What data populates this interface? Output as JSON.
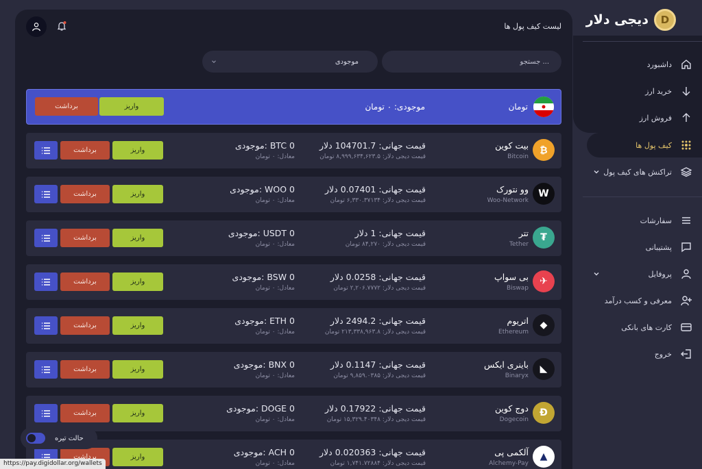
{
  "brand": {
    "name": "دیجی دلار",
    "coin_letter": "D"
  },
  "sidebar": {
    "items": [
      {
        "label": "داشبورد",
        "icon": "home-icon"
      },
      {
        "label": "خرید ارز",
        "icon": "arrow-down-icon"
      },
      {
        "label": "فروش ارز",
        "icon": "arrow-up-icon"
      },
      {
        "label": "کیف پول ها",
        "icon": "wallet-dots-icon",
        "active": true
      },
      {
        "label": "تراکنش های کیف پول",
        "icon": "layers-icon",
        "has_chevron": true
      },
      {
        "label": "سفارشات",
        "icon": "list-icon"
      },
      {
        "label": "پشتیبانی",
        "icon": "chat-icon"
      },
      {
        "label": "پروفایل",
        "icon": "user-icon",
        "has_chevron": true
      },
      {
        "label": "معرفی و کسب درآمد",
        "icon": "user-plus-icon"
      },
      {
        "label": "کارت های بانکی",
        "icon": "card-icon"
      },
      {
        "label": "خروج",
        "icon": "logout-icon"
      }
    ]
  },
  "header": {
    "title": "لیست کیف پول ها"
  },
  "search": {
    "placeholder": "جستجو ..."
  },
  "filter": {
    "selected": "موجودی"
  },
  "toman": {
    "name": "تومان",
    "balance": "موجودی: ۰ تومان",
    "deposit_label": "واریز",
    "withdraw_label": "برداشت"
  },
  "coins": [
    {
      "name": "بیت کوین",
      "sub": "Bitcoin",
      "price": "قیمت جهانی: 104701.7 دلار",
      "price_sub": "قیمت دیجی دلار: ۸,۹۹۹,۶۳۴,۶۲۳.۵ تومان",
      "balance": "موجودی: BTC 0",
      "balance_sub": "معادل: ۰ تومان",
      "icon_color": "#f0a22a",
      "icon_symbol": "₿"
    },
    {
      "name": "وو نتورک",
      "sub": "Woo-Network",
      "price": "قیمت جهانی: 0.07401 دلار",
      "price_sub": "قیمت دیجی دلار: ۶,۳۳۰.۳۷۱۳۴ تومان",
      "balance": "موجودی: WOO 0",
      "balance_sub": "معادل: ۰ تومان",
      "icon_color": "#0e0e12",
      "icon_symbol": "W"
    },
    {
      "name": "تتر",
      "sub": "Tether",
      "price": "قیمت جهانی: 1 دلار",
      "price_sub": "قیمت دیجی دلار: ۸۴,۲۷۰ تومان",
      "balance": "موجودی: USDT 0",
      "balance_sub": "معادل: ۰ تومان",
      "icon_color": "#3aa78f",
      "icon_symbol": "₮"
    },
    {
      "name": "بی سواپ",
      "sub": "Biswap",
      "price": "قیمت جهانی: 0.0258 دلار",
      "price_sub": "قیمت دیجی دلار: ۲,۲۰۶.۷۷۷۲ تومان",
      "balance": "موجودی: BSW 0",
      "balance_sub": "معادل: ۰ تومان",
      "icon_color": "#e8424f",
      "icon_symbol": "✈"
    },
    {
      "name": "اتریوم",
      "sub": "Ethereum",
      "price": "قیمت جهانی: 2494.2 دلار",
      "price_sub": "قیمت دیجی دلار: ۲۱۳,۳۳۸,۹۶۳.۸ تومان",
      "balance": "موجودی: ETH 0",
      "balance_sub": "معادل: ۰ تومان",
      "icon_color": "#16161e",
      "icon_symbol": "◆"
    },
    {
      "name": "باینری ایکس",
      "sub": "Binaryx",
      "price": "قیمت جهانی: 0.1147 دلار",
      "price_sub": "قیمت دیجی دلار: ۹,۸۵۹.۰۳۸۵ تومان",
      "balance": "موجودی: BNX 0",
      "balance_sub": "معادل: ۰ تومان",
      "icon_color": "#15151c",
      "icon_symbol": "◣"
    },
    {
      "name": "دوج کوین",
      "sub": "Dogecoin",
      "price": "قیمت جهانی: 0.17922 دلار",
      "price_sub": "قیمت دیجی دلار: ۱۵,۳۲۹.۴۰۳۴۸ تومان",
      "balance": "موجودی: DOGE 0",
      "balance_sub": "معادل: ۰ تومان",
      "icon_color": "#c2a633",
      "icon_symbol": "Ð"
    },
    {
      "name": "آلکمی پی",
      "sub": "Alchemy-Pay",
      "price": "قیمت جهانی: 0.020363 دلار",
      "price_sub": "قیمت دیجی دلار: ۱,۷۴۱.۷۲۸۸۴ تومان",
      "balance": "موجودی: ACH 0",
      "balance_sub": "معادل: ۰ تومان",
      "icon_color": "#ffffff",
      "icon_symbol": "▲"
    }
  ],
  "row_buttons": {
    "deposit": "واریز",
    "withdraw": "برداشت"
  },
  "dark_mode": {
    "label": "حالت تیره",
    "enabled": true
  },
  "status_bar": {
    "url": "https://pay.digidollar.org/wallets"
  },
  "colors": {
    "accent": "#4651c7",
    "deposit": "#a6c73a",
    "withdraw": "#b84b35",
    "active": "#e4c46a"
  }
}
